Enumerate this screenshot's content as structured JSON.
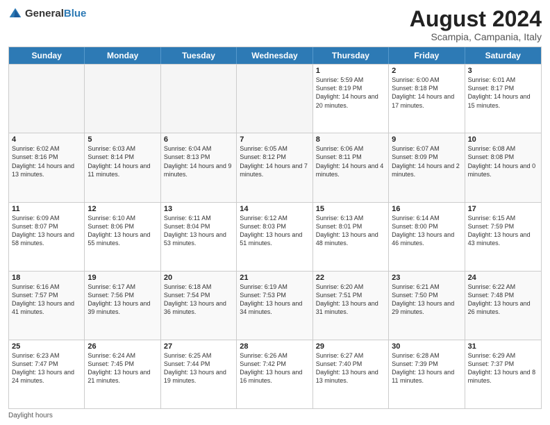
{
  "logo": {
    "general": "General",
    "blue": "Blue"
  },
  "title": "August 2024",
  "subtitle": "Scampia, Campania, Italy",
  "days": [
    "Sunday",
    "Monday",
    "Tuesday",
    "Wednesday",
    "Thursday",
    "Friday",
    "Saturday"
  ],
  "weeks": [
    [
      {
        "day": "",
        "info": "",
        "empty": true
      },
      {
        "day": "",
        "info": "",
        "empty": true
      },
      {
        "day": "",
        "info": "",
        "empty": true
      },
      {
        "day": "",
        "info": "",
        "empty": true
      },
      {
        "day": "1",
        "info": "Sunrise: 5:59 AM\nSunset: 8:19 PM\nDaylight: 14 hours and 20 minutes.",
        "empty": false
      },
      {
        "day": "2",
        "info": "Sunrise: 6:00 AM\nSunset: 8:18 PM\nDaylight: 14 hours and 17 minutes.",
        "empty": false
      },
      {
        "day": "3",
        "info": "Sunrise: 6:01 AM\nSunset: 8:17 PM\nDaylight: 14 hours and 15 minutes.",
        "empty": false
      }
    ],
    [
      {
        "day": "4",
        "info": "Sunrise: 6:02 AM\nSunset: 8:16 PM\nDaylight: 14 hours and 13 minutes.",
        "empty": false
      },
      {
        "day": "5",
        "info": "Sunrise: 6:03 AM\nSunset: 8:14 PM\nDaylight: 14 hours and 11 minutes.",
        "empty": false
      },
      {
        "day": "6",
        "info": "Sunrise: 6:04 AM\nSunset: 8:13 PM\nDaylight: 14 hours and 9 minutes.",
        "empty": false
      },
      {
        "day": "7",
        "info": "Sunrise: 6:05 AM\nSunset: 8:12 PM\nDaylight: 14 hours and 7 minutes.",
        "empty": false
      },
      {
        "day": "8",
        "info": "Sunrise: 6:06 AM\nSunset: 8:11 PM\nDaylight: 14 hours and 4 minutes.",
        "empty": false
      },
      {
        "day": "9",
        "info": "Sunrise: 6:07 AM\nSunset: 8:09 PM\nDaylight: 14 hours and 2 minutes.",
        "empty": false
      },
      {
        "day": "10",
        "info": "Sunrise: 6:08 AM\nSunset: 8:08 PM\nDaylight: 14 hours and 0 minutes.",
        "empty": false
      }
    ],
    [
      {
        "day": "11",
        "info": "Sunrise: 6:09 AM\nSunset: 8:07 PM\nDaylight: 13 hours and 58 minutes.",
        "empty": false
      },
      {
        "day": "12",
        "info": "Sunrise: 6:10 AM\nSunset: 8:06 PM\nDaylight: 13 hours and 55 minutes.",
        "empty": false
      },
      {
        "day": "13",
        "info": "Sunrise: 6:11 AM\nSunset: 8:04 PM\nDaylight: 13 hours and 53 minutes.",
        "empty": false
      },
      {
        "day": "14",
        "info": "Sunrise: 6:12 AM\nSunset: 8:03 PM\nDaylight: 13 hours and 51 minutes.",
        "empty": false
      },
      {
        "day": "15",
        "info": "Sunrise: 6:13 AM\nSunset: 8:01 PM\nDaylight: 13 hours and 48 minutes.",
        "empty": false
      },
      {
        "day": "16",
        "info": "Sunrise: 6:14 AM\nSunset: 8:00 PM\nDaylight: 13 hours and 46 minutes.",
        "empty": false
      },
      {
        "day": "17",
        "info": "Sunrise: 6:15 AM\nSunset: 7:59 PM\nDaylight: 13 hours and 43 minutes.",
        "empty": false
      }
    ],
    [
      {
        "day": "18",
        "info": "Sunrise: 6:16 AM\nSunset: 7:57 PM\nDaylight: 13 hours and 41 minutes.",
        "empty": false
      },
      {
        "day": "19",
        "info": "Sunrise: 6:17 AM\nSunset: 7:56 PM\nDaylight: 13 hours and 39 minutes.",
        "empty": false
      },
      {
        "day": "20",
        "info": "Sunrise: 6:18 AM\nSunset: 7:54 PM\nDaylight: 13 hours and 36 minutes.",
        "empty": false
      },
      {
        "day": "21",
        "info": "Sunrise: 6:19 AM\nSunset: 7:53 PM\nDaylight: 13 hours and 34 minutes.",
        "empty": false
      },
      {
        "day": "22",
        "info": "Sunrise: 6:20 AM\nSunset: 7:51 PM\nDaylight: 13 hours and 31 minutes.",
        "empty": false
      },
      {
        "day": "23",
        "info": "Sunrise: 6:21 AM\nSunset: 7:50 PM\nDaylight: 13 hours and 29 minutes.",
        "empty": false
      },
      {
        "day": "24",
        "info": "Sunrise: 6:22 AM\nSunset: 7:48 PM\nDaylight: 13 hours and 26 minutes.",
        "empty": false
      }
    ],
    [
      {
        "day": "25",
        "info": "Sunrise: 6:23 AM\nSunset: 7:47 PM\nDaylight: 13 hours and 24 minutes.",
        "empty": false
      },
      {
        "day": "26",
        "info": "Sunrise: 6:24 AM\nSunset: 7:45 PM\nDaylight: 13 hours and 21 minutes.",
        "empty": false
      },
      {
        "day": "27",
        "info": "Sunrise: 6:25 AM\nSunset: 7:44 PM\nDaylight: 13 hours and 19 minutes.",
        "empty": false
      },
      {
        "day": "28",
        "info": "Sunrise: 6:26 AM\nSunset: 7:42 PM\nDaylight: 13 hours and 16 minutes.",
        "empty": false
      },
      {
        "day": "29",
        "info": "Sunrise: 6:27 AM\nSunset: 7:40 PM\nDaylight: 13 hours and 13 minutes.",
        "empty": false
      },
      {
        "day": "30",
        "info": "Sunrise: 6:28 AM\nSunset: 7:39 PM\nDaylight: 13 hours and 11 minutes.",
        "empty": false
      },
      {
        "day": "31",
        "info": "Sunrise: 6:29 AM\nSunset: 7:37 PM\nDaylight: 13 hours and 8 minutes.",
        "empty": false
      }
    ]
  ],
  "footer": "Daylight hours"
}
